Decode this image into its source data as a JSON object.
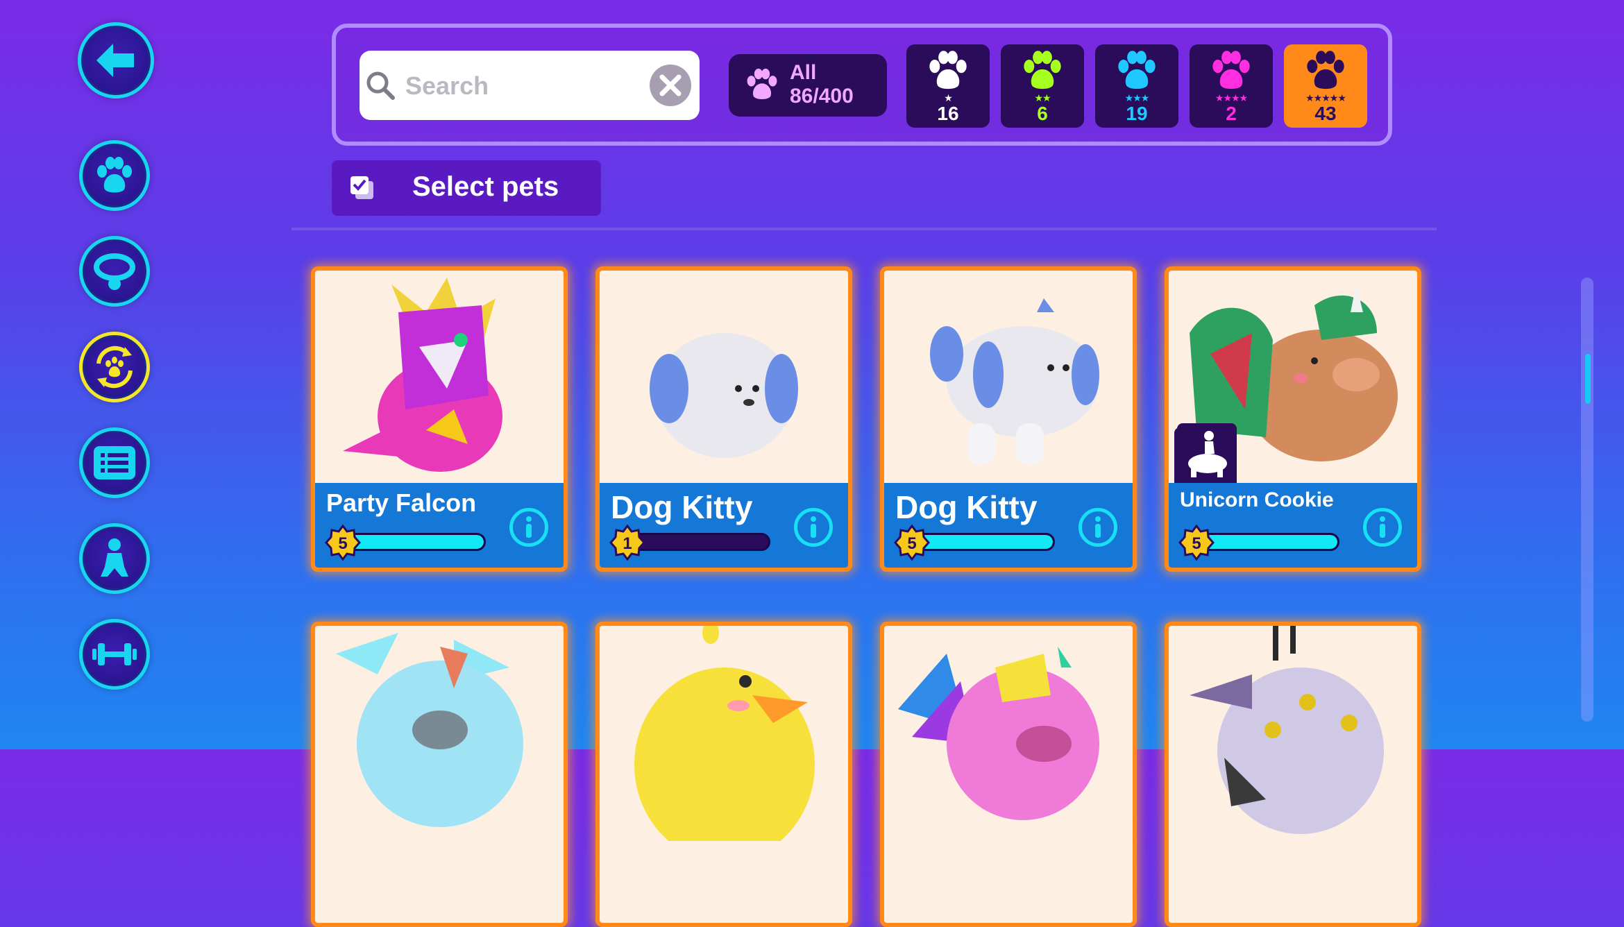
{
  "sidebar": {
    "items": [
      {
        "icon": "back-arrow-icon"
      },
      {
        "icon": "paw-icon"
      },
      {
        "icon": "collar-icon"
      },
      {
        "icon": "paw-swap-icon",
        "active": true
      },
      {
        "icon": "list-icon"
      },
      {
        "icon": "rider-icon"
      },
      {
        "icon": "dumbbell-icon"
      }
    ]
  },
  "search": {
    "placeholder": "Search"
  },
  "filters": {
    "all_label": "All",
    "all_count": "86/400",
    "rarities": [
      {
        "stars": "★",
        "count": "16",
        "color": "#ffffff"
      },
      {
        "stars": "★★",
        "count": "6",
        "color": "#a6ff1f"
      },
      {
        "stars": "★★★",
        "count": "19",
        "color": "#1fc8ff"
      },
      {
        "stars": "★★★★",
        "count": "2",
        "color": "#ff2ee0"
      },
      {
        "stars": "★★★★★",
        "count": "43",
        "color": "#2a0c5a"
      }
    ]
  },
  "select_button": {
    "label": "Select pets"
  },
  "cards": [
    {
      "name": "Party Falcon",
      "level": "5",
      "progress": 1.0
    },
    {
      "name": "Dog Kitty",
      "level": "1",
      "progress": 0.0
    },
    {
      "name": "Dog Kitty",
      "level": "5",
      "progress": 1.0
    },
    {
      "name": "Unicorn Cookie",
      "level": "5",
      "progress": 1.0
    }
  ],
  "colors": {
    "accent": "#19d6f0",
    "card_border": "#ff8a1a",
    "card_bar": "#1577d6",
    "rarity5": "#ff8a1a"
  }
}
